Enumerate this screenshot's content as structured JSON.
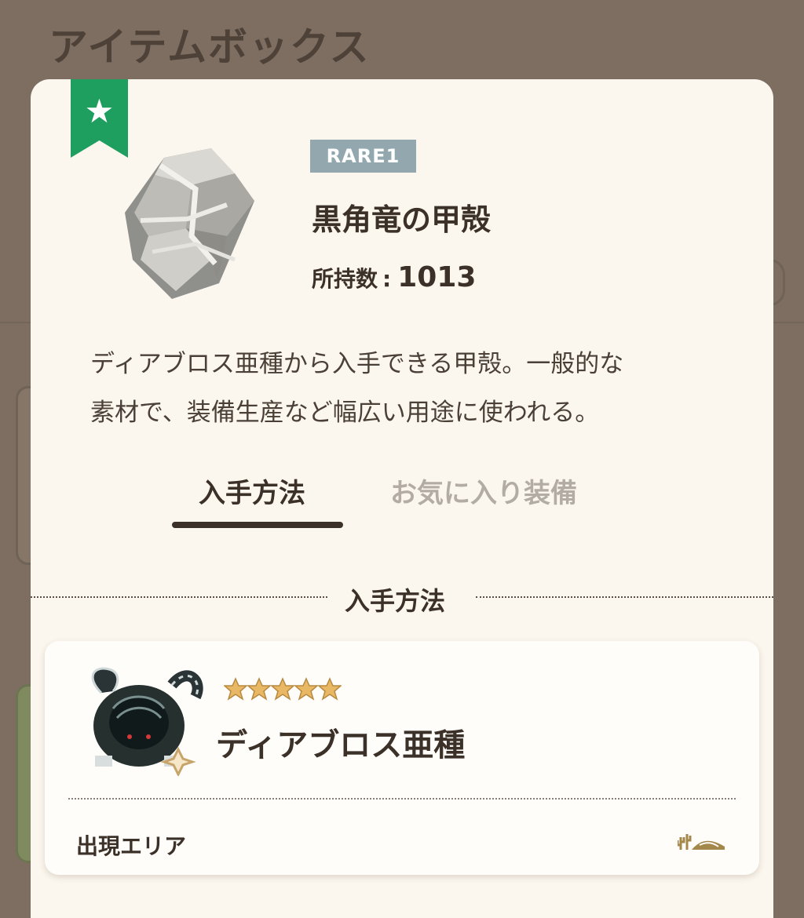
{
  "page": {
    "title": "アイテムボックス"
  },
  "item": {
    "rarity": "RARE1",
    "name": "黒角竜の甲殻",
    "owned_label": "所持数",
    "owned_sep": ":",
    "owned_count": "1013",
    "description_lines": [
      "ディアブロス亜種から入手できる甲殻。一般的な",
      "素材で、装備生産など幅広い用途に使われる。"
    ],
    "favorite": true
  },
  "tabs": [
    {
      "label": "入手方法",
      "active": true
    },
    {
      "label": "お気に入り装備",
      "active": false
    }
  ],
  "section": {
    "title": "入手方法"
  },
  "source": {
    "monster_name": "ディアブロス亜種",
    "stars": 5,
    "area_label": "出現エリア",
    "area_icon": "desert-area-icon"
  },
  "colors": {
    "favorite_ribbon": "#1f9f5f",
    "rarity_badge": "#93a8ae",
    "panel": "#fbf6ee",
    "star": "#e9b865"
  }
}
